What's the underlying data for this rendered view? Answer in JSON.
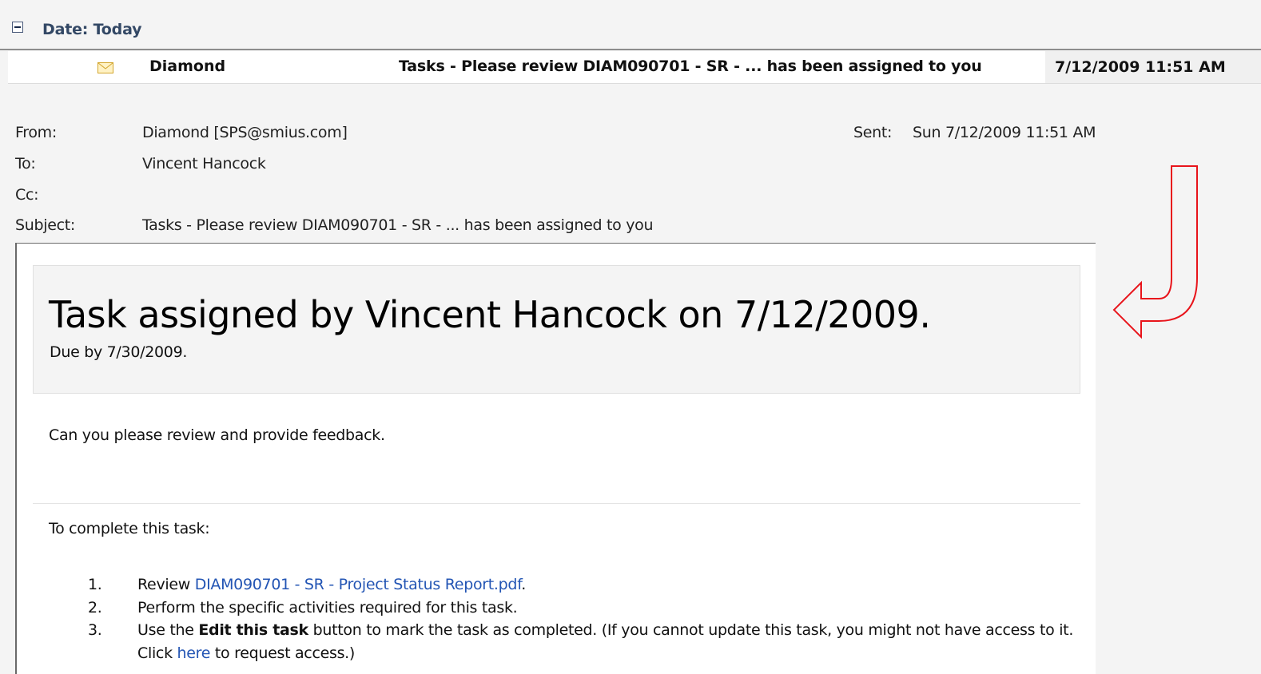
{
  "group": {
    "label": "Date: Today"
  },
  "mail_row": {
    "from": "Diamond",
    "subject": "Tasks - Please review DIAM090701 - SR - ... has been assigned to you",
    "received": "7/12/2009 11:51 AM",
    "icon": "envelope-icon"
  },
  "headers": {
    "from_label": "From:",
    "from_value": "Diamond [SPS@smius.com]",
    "to_label": "To:",
    "to_value": "Vincent Hancock",
    "cc_label": "Cc:",
    "cc_value": "",
    "subject_label": "Subject:",
    "subject_value": "Tasks - Please review DIAM090701 - SR - ... has been assigned to you",
    "sent_label": "Sent:",
    "sent_value": "Sun 7/12/2009 11:51 AM"
  },
  "body": {
    "title": "Task assigned by Vincent Hancock on 7/12/2009.",
    "due": "Due by 7/30/2009.",
    "message": "Can you please review and provide feedback.",
    "complete_intro": "To complete this task:",
    "steps": [
      {
        "num": "1.",
        "prefix": "Review ",
        "link": "DIAM090701 - SR - Project Status Report.pdf",
        "suffix": "."
      },
      {
        "num": "2.",
        "text": "Perform the specific activities required for this task."
      },
      {
        "num": "3.",
        "prefix": "Use the ",
        "bold": "Edit this task",
        "middle": " button to mark the task as completed. (If you cannot update this task, you might not have access to it. Click ",
        "link": "here",
        "suffix": " to request access.)"
      }
    ]
  },
  "colors": {
    "link": "#2355b4",
    "annotation_arrow": "#e8141b",
    "group_label": "#334865"
  }
}
